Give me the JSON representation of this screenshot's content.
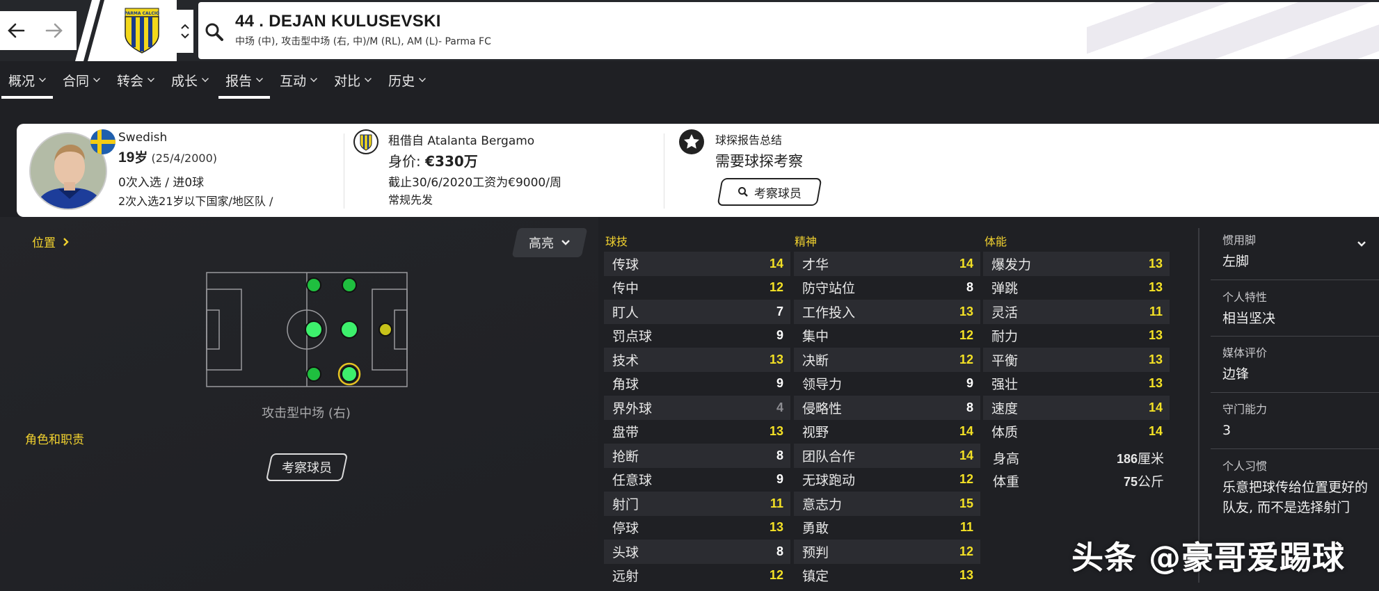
{
  "header": {
    "player_title": "44 . DEJAN KULUSEVSKI",
    "player_subtitle": "中场 (中), 攻击型中场 (右, 中)/M (RL), AM (L)- Parma FC",
    "crest_text": "PARMA CALCIO"
  },
  "tabs": [
    {
      "label": "概况",
      "active": true
    },
    {
      "label": "合同",
      "active": false
    },
    {
      "label": "转会",
      "active": false
    },
    {
      "label": "成长",
      "active": false
    },
    {
      "label": "报告",
      "active": true
    },
    {
      "label": "互动",
      "active": false
    },
    {
      "label": "对比",
      "active": false
    },
    {
      "label": "历史",
      "active": false
    }
  ],
  "info": {
    "nationality": "Swedish",
    "age": "19",
    "age_unit": "岁",
    "dob": "(25/4/2000)",
    "caps": "0次入选 / 进0球",
    "youth_caps": "2次入选21岁以下国家/地区队 /",
    "loan": "租借自 Atalanta Bergamo",
    "value_label": "身价: ",
    "value": "€330万",
    "contract": "截止30/6/2020工资为€9000/周",
    "role": "常规先发",
    "report_title": "球探报告总结",
    "report_status": "需要球探考察",
    "scout_button": "考察球员"
  },
  "left": {
    "position_link": "位置",
    "highlight_dropdown": "高亮",
    "position_label": "攻击型中场 (右)",
    "roles_label": "角色和职责",
    "scout_button": "考察球员"
  },
  "attributes": {
    "technical_title": "球技",
    "mental_title": "精神",
    "physical_title": "体能",
    "technical": [
      {
        "name": "传球",
        "value": "14"
      },
      {
        "name": "传中",
        "value": "12"
      },
      {
        "name": "盯人",
        "value": "7"
      },
      {
        "name": "罚点球",
        "value": "9"
      },
      {
        "name": "技术",
        "value": "13"
      },
      {
        "name": "角球",
        "value": "9"
      },
      {
        "name": "界外球",
        "value": "4"
      },
      {
        "name": "盘带",
        "value": "13"
      },
      {
        "name": "抢断",
        "value": "8"
      },
      {
        "name": "任意球",
        "value": "9"
      },
      {
        "name": "射门",
        "value": "11"
      },
      {
        "name": "停球",
        "value": "13"
      },
      {
        "name": "头球",
        "value": "8"
      },
      {
        "name": "远射",
        "value": "12"
      }
    ],
    "mental": [
      {
        "name": "才华",
        "value": "14"
      },
      {
        "name": "防守站位",
        "value": "8"
      },
      {
        "name": "工作投入",
        "value": "13"
      },
      {
        "name": "集中",
        "value": "12"
      },
      {
        "name": "决断",
        "value": "12"
      },
      {
        "name": "领导力",
        "value": "9"
      },
      {
        "name": "侵略性",
        "value": "8"
      },
      {
        "name": "视野",
        "value": "14"
      },
      {
        "name": "团队合作",
        "value": "14"
      },
      {
        "name": "无球跑动",
        "value": "12"
      },
      {
        "name": "意志力",
        "value": "15"
      },
      {
        "name": "勇敢",
        "value": "11"
      },
      {
        "name": "预判",
        "value": "12"
      },
      {
        "name": "镇定",
        "value": "13"
      }
    ],
    "physical": [
      {
        "name": "爆发力",
        "value": "13"
      },
      {
        "name": "弹跳",
        "value": "13"
      },
      {
        "name": "灵活",
        "value": "11"
      },
      {
        "name": "耐力",
        "value": "13"
      },
      {
        "name": "平衡",
        "value": "13"
      },
      {
        "name": "强壮",
        "value": "13"
      },
      {
        "name": "速度",
        "value": "14"
      },
      {
        "name": "体质",
        "value": "14"
      }
    ],
    "height_label": "身高",
    "height_value": "186",
    "height_unit": "厘米",
    "weight_label": "体重",
    "weight_value": "75",
    "weight_unit": "公斤"
  },
  "side": {
    "foot_label": "惯用脚",
    "foot_value": "左脚",
    "trait_label": "个人特性",
    "trait_value": "相当坚决",
    "media_label": "媒体评价",
    "media_value": "边锋",
    "gk_label": "守门能力",
    "gk_value": "3",
    "habit_label": "个人习惯",
    "habit_value": "乐意把球传给位置更好的队友, 而不是选择射门"
  },
  "watermark": "头条 @豪哥爱踢球",
  "colors": {
    "accent_yellow": "#f4e125",
    "label_yellow": "#f2d22f",
    "bg": "#1f2024",
    "pitch_green_bright": "#3df06c",
    "pitch_green_dark": "#1fbf3f",
    "pitch_yellow": "#c7c21a"
  }
}
